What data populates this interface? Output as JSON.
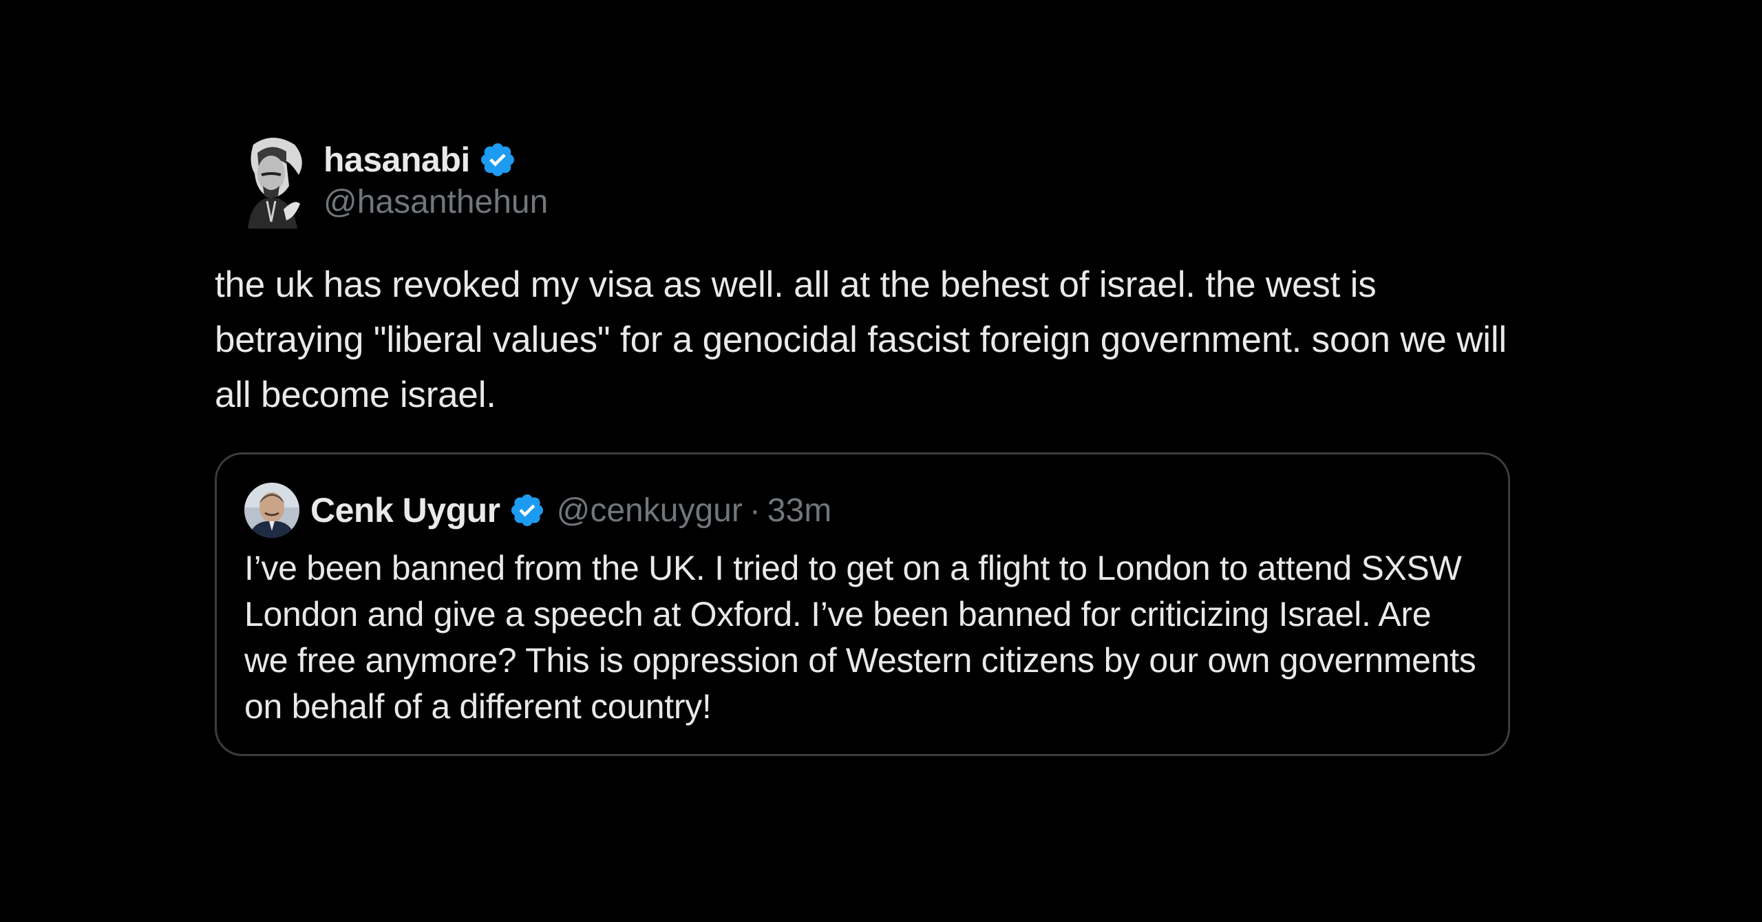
{
  "tweet": {
    "display_name": "hasanabi",
    "handle": "@hasanthehun",
    "verified": true,
    "text": "the uk has revoked my visa as well. all at the behest of israel. the west is betraying \"liberal values\" for a genocidal fascist foreign government. soon we will all become israel.",
    "avatar_icon": "avatar-hasanabi-icon",
    "verified_icon": "verified-badge-icon"
  },
  "quoted_tweet": {
    "display_name": "Cenk Uygur",
    "handle": "@cenkuygur",
    "separator": "·",
    "time": "33m",
    "verified": true,
    "text": "I’ve been banned from the UK. I tried to get on a flight to London to attend SXSW London and give a speech at Oxford. I’ve been banned for criticizing Israel. Are we free anymore? This is oppression of Western citizens by our own governments on behalf of a different country!",
    "avatar_icon": "avatar-cenkuygur-icon",
    "verified_icon": "verified-badge-icon"
  },
  "colors": {
    "background": "#000000",
    "text_primary": "#e7e9ea",
    "text_secondary": "#71767b",
    "verified_blue": "#1d9bf0",
    "quote_border": "#3a3d41"
  }
}
